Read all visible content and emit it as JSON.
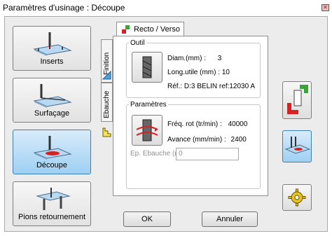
{
  "window": {
    "title": "Paramètres d'usinage : Découpe"
  },
  "operations": [
    {
      "label": "Inserts",
      "icon": "inserts-icon"
    },
    {
      "label": "Surfaçage",
      "icon": "surfacage-icon"
    },
    {
      "label": "Découpe",
      "icon": "decoupe-icon",
      "selected": true
    },
    {
      "label": "Pions retournement",
      "icon": "pions-retournement-icon"
    }
  ],
  "tabs": {
    "active": "Recto / Verso",
    "vertical": [
      "Finition",
      "Ebauche"
    ]
  },
  "outil": {
    "legend": "Outil",
    "diam_label": "Diam.(mm) :",
    "diam_value": "3",
    "long_label": "Long.utile (mm) :",
    "long_value": "10",
    "ref_label": "Réf.:",
    "ref_value": "D:3 BELIN ref:12030 A"
  },
  "parametres": {
    "legend": "Paramètres",
    "freq_label": "Fréq. rot (tr/min) :",
    "freq_value": "40000",
    "avance_label": "Avance (mm/min) :",
    "avance_value": "2400",
    "ep_label": "Ep. Ebauche (mm) :",
    "ep_value": "0"
  },
  "buttons": {
    "ok": "OK",
    "cancel": "Annuler"
  },
  "side_icons": [
    "layers-swap-icon",
    "board-tools-icon",
    "gear-icon"
  ],
  "colors": {
    "accent_blue": "#9fd0f3",
    "red": "#d62222",
    "green": "#3aa33a"
  }
}
